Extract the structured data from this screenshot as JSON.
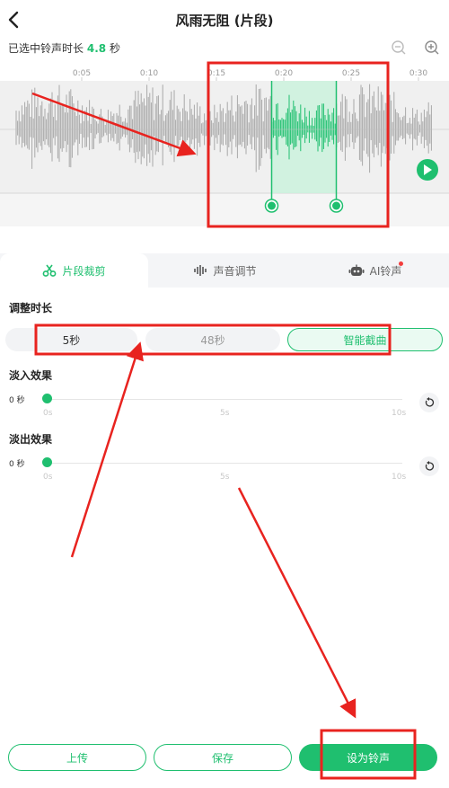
{
  "header": {
    "title": "风雨无阻 (片段)",
    "back_icon": "chevron-left-icon"
  },
  "selection": {
    "prefix": "已选中铃声时长",
    "value": "4.8",
    "unit": "秒"
  },
  "zoom": {
    "out_icon": "zoom-out-icon",
    "in_icon": "zoom-in-icon"
  },
  "timeline": {
    "ticks": [
      "0:05",
      "0:10",
      "0:15",
      "0:20",
      "0:25",
      "0:30"
    ]
  },
  "waveform": {
    "selected_start_sec": 19.1,
    "selected_end_sec": 23.9,
    "play_icon": "play-icon",
    "accent": "#1fbf6f"
  },
  "tabs": [
    {
      "label": "片段裁剪",
      "icon": "scissors-icon",
      "active": true
    },
    {
      "label": "声音调节",
      "icon": "sound-wave-icon",
      "active": false
    },
    {
      "label": "AI铃声",
      "icon": "robot-icon",
      "active": false,
      "badge": true
    }
  ],
  "duration": {
    "title": "调整时长",
    "options": [
      {
        "label": "5秒",
        "active": false
      },
      {
        "label": "48秒",
        "active": false
      },
      {
        "label": "智能截曲",
        "active": true
      }
    ]
  },
  "fade_in": {
    "title": "淡入效果",
    "value": "0 秒",
    "ticks": [
      "0s",
      "5s",
      "10s"
    ],
    "level": 0
  },
  "fade_out": {
    "title": "淡出效果",
    "value": "0 秒",
    "ticks": [
      "0s",
      "5s",
      "10s"
    ],
    "level": 0
  },
  "footer": {
    "upload": "上传",
    "save": "保存",
    "set_ringtone": "设为铃声"
  },
  "colors": {
    "accent": "#1fbf6f",
    "annotation": "#e8231f"
  }
}
